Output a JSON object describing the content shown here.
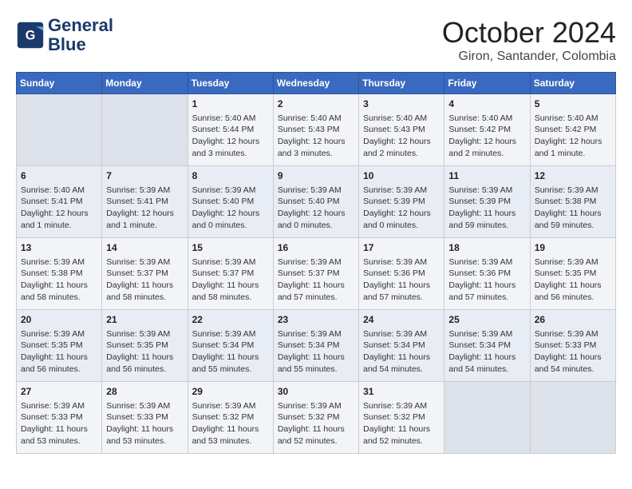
{
  "header": {
    "logo_line1": "General",
    "logo_line2": "Blue",
    "month": "October 2024",
    "location": "Giron, Santander, Colombia"
  },
  "days_of_week": [
    "Sunday",
    "Monday",
    "Tuesday",
    "Wednesday",
    "Thursday",
    "Friday",
    "Saturday"
  ],
  "weeks": [
    [
      {
        "day": "",
        "info": ""
      },
      {
        "day": "",
        "info": ""
      },
      {
        "day": "1",
        "info": "Sunrise: 5:40 AM\nSunset: 5:44 PM\nDaylight: 12 hours\nand 3 minutes."
      },
      {
        "day": "2",
        "info": "Sunrise: 5:40 AM\nSunset: 5:43 PM\nDaylight: 12 hours\nand 3 minutes."
      },
      {
        "day": "3",
        "info": "Sunrise: 5:40 AM\nSunset: 5:43 PM\nDaylight: 12 hours\nand 2 minutes."
      },
      {
        "day": "4",
        "info": "Sunrise: 5:40 AM\nSunset: 5:42 PM\nDaylight: 12 hours\nand 2 minutes."
      },
      {
        "day": "5",
        "info": "Sunrise: 5:40 AM\nSunset: 5:42 PM\nDaylight: 12 hours\nand 1 minute."
      }
    ],
    [
      {
        "day": "6",
        "info": "Sunrise: 5:40 AM\nSunset: 5:41 PM\nDaylight: 12 hours\nand 1 minute."
      },
      {
        "day": "7",
        "info": "Sunrise: 5:39 AM\nSunset: 5:41 PM\nDaylight: 12 hours\nand 1 minute."
      },
      {
        "day": "8",
        "info": "Sunrise: 5:39 AM\nSunset: 5:40 PM\nDaylight: 12 hours\nand 0 minutes."
      },
      {
        "day": "9",
        "info": "Sunrise: 5:39 AM\nSunset: 5:40 PM\nDaylight: 12 hours\nand 0 minutes."
      },
      {
        "day": "10",
        "info": "Sunrise: 5:39 AM\nSunset: 5:39 PM\nDaylight: 12 hours\nand 0 minutes."
      },
      {
        "day": "11",
        "info": "Sunrise: 5:39 AM\nSunset: 5:39 PM\nDaylight: 11 hours\nand 59 minutes."
      },
      {
        "day": "12",
        "info": "Sunrise: 5:39 AM\nSunset: 5:38 PM\nDaylight: 11 hours\nand 59 minutes."
      }
    ],
    [
      {
        "day": "13",
        "info": "Sunrise: 5:39 AM\nSunset: 5:38 PM\nDaylight: 11 hours\nand 58 minutes."
      },
      {
        "day": "14",
        "info": "Sunrise: 5:39 AM\nSunset: 5:37 PM\nDaylight: 11 hours\nand 58 minutes."
      },
      {
        "day": "15",
        "info": "Sunrise: 5:39 AM\nSunset: 5:37 PM\nDaylight: 11 hours\nand 58 minutes."
      },
      {
        "day": "16",
        "info": "Sunrise: 5:39 AM\nSunset: 5:37 PM\nDaylight: 11 hours\nand 57 minutes."
      },
      {
        "day": "17",
        "info": "Sunrise: 5:39 AM\nSunset: 5:36 PM\nDaylight: 11 hours\nand 57 minutes."
      },
      {
        "day": "18",
        "info": "Sunrise: 5:39 AM\nSunset: 5:36 PM\nDaylight: 11 hours\nand 57 minutes."
      },
      {
        "day": "19",
        "info": "Sunrise: 5:39 AM\nSunset: 5:35 PM\nDaylight: 11 hours\nand 56 minutes."
      }
    ],
    [
      {
        "day": "20",
        "info": "Sunrise: 5:39 AM\nSunset: 5:35 PM\nDaylight: 11 hours\nand 56 minutes."
      },
      {
        "day": "21",
        "info": "Sunrise: 5:39 AM\nSunset: 5:35 PM\nDaylight: 11 hours\nand 56 minutes."
      },
      {
        "day": "22",
        "info": "Sunrise: 5:39 AM\nSunset: 5:34 PM\nDaylight: 11 hours\nand 55 minutes."
      },
      {
        "day": "23",
        "info": "Sunrise: 5:39 AM\nSunset: 5:34 PM\nDaylight: 11 hours\nand 55 minutes."
      },
      {
        "day": "24",
        "info": "Sunrise: 5:39 AM\nSunset: 5:34 PM\nDaylight: 11 hours\nand 54 minutes."
      },
      {
        "day": "25",
        "info": "Sunrise: 5:39 AM\nSunset: 5:34 PM\nDaylight: 11 hours\nand 54 minutes."
      },
      {
        "day": "26",
        "info": "Sunrise: 5:39 AM\nSunset: 5:33 PM\nDaylight: 11 hours\nand 54 minutes."
      }
    ],
    [
      {
        "day": "27",
        "info": "Sunrise: 5:39 AM\nSunset: 5:33 PM\nDaylight: 11 hours\nand 53 minutes."
      },
      {
        "day": "28",
        "info": "Sunrise: 5:39 AM\nSunset: 5:33 PM\nDaylight: 11 hours\nand 53 minutes."
      },
      {
        "day": "29",
        "info": "Sunrise: 5:39 AM\nSunset: 5:32 PM\nDaylight: 11 hours\nand 53 minutes."
      },
      {
        "day": "30",
        "info": "Sunrise: 5:39 AM\nSunset: 5:32 PM\nDaylight: 11 hours\nand 52 minutes."
      },
      {
        "day": "31",
        "info": "Sunrise: 5:39 AM\nSunset: 5:32 PM\nDaylight: 11 hours\nand 52 minutes."
      },
      {
        "day": "",
        "info": ""
      },
      {
        "day": "",
        "info": ""
      }
    ]
  ]
}
